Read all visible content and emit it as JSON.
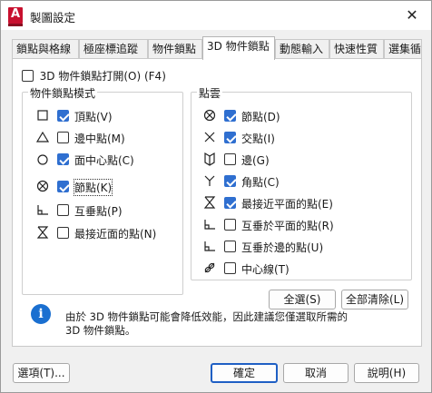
{
  "window": {
    "title": "製圖設定",
    "app_icon_letter": "A",
    "close_glyph": "✕"
  },
  "tabs": [
    {
      "label": "鎖點與格線",
      "active": false
    },
    {
      "label": "極座標追蹤",
      "active": false
    },
    {
      "label": "物件鎖點",
      "active": false
    },
    {
      "label": "3D 物件鎖點",
      "active": true
    },
    {
      "label": "動態輸入",
      "active": false
    },
    {
      "label": "快速性質",
      "active": false
    },
    {
      "label": "選集循環",
      "active": false
    }
  ],
  "snap3d_toggle": {
    "label": "3D 物件鎖點打開(O) (F4)",
    "checked": false
  },
  "object_snap_modes": {
    "title": "物件鎖點模式",
    "items": [
      {
        "label": "頂點(V)",
        "checked": true,
        "icon": "square-icon",
        "symbol": "□"
      },
      {
        "label": "邊中點(M)",
        "checked": false,
        "icon": "triangle-icon",
        "symbol": "△"
      },
      {
        "label": "面中心點(C)",
        "checked": true,
        "icon": "circle-icon",
        "symbol": "○"
      },
      {
        "label": "節點(K)",
        "checked": true,
        "icon": "node-icon",
        "symbol": "⊗"
      },
      {
        "label": "互垂點(P)",
        "checked": false,
        "icon": "perpendicular-icon",
        "symbol": "∟"
      },
      {
        "label": "最接近面的點(N)",
        "checked": false,
        "icon": "hourglass-icon",
        "symbol": "⧗"
      }
    ]
  },
  "point_cloud": {
    "title": "點雲",
    "items": [
      {
        "label": "節點(D)",
        "checked": true,
        "icon": "node-icon",
        "symbol": "⊗"
      },
      {
        "label": "交點(I)",
        "checked": true,
        "icon": "intersection-icon",
        "symbol": "✕"
      },
      {
        "label": "邊(G)",
        "checked": false,
        "icon": "edge-icon",
        "symbol": "◫"
      },
      {
        "label": "角點(C)",
        "checked": true,
        "icon": "corner-icon",
        "symbol": "Y"
      },
      {
        "label": "最接近平面的點(E)",
        "checked": true,
        "icon": "hourglass-icon",
        "symbol": "⧗"
      },
      {
        "label": "互垂於平面的點(R)",
        "checked": false,
        "icon": "perpendicular-icon",
        "symbol": "∟"
      },
      {
        "label": "互垂於邊的點(U)",
        "checked": false,
        "icon": "perpendicular-icon",
        "symbol": "∟"
      },
      {
        "label": "中心線(T)",
        "checked": false,
        "icon": "centerline-icon",
        "symbol": "⌀"
      }
    ]
  },
  "buttons": {
    "select_all": "全選(S)",
    "clear_all": "全部清除(L)",
    "options": "選項(T)...",
    "ok": "確定",
    "cancel": "取消",
    "help": "說明(H)"
  },
  "info": {
    "line1": "由於 3D 物件鎖點可能會降低效能，因此建議您僅選取所需的",
    "line2": "3D 物件鎖點。"
  },
  "colors": {
    "accent": "#2f6fd0",
    "info_icon": "#1a6fd0",
    "app_icon": "#c8102e"
  }
}
